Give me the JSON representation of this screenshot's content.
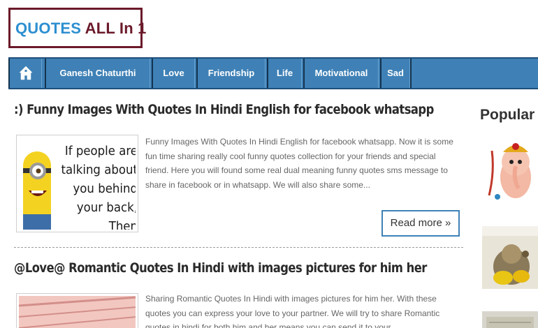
{
  "logo": {
    "part1": "QUOTES",
    "part2": "ALL In 1"
  },
  "nav": {
    "home_icon": "home-icon",
    "items": [
      {
        "label": "Ganesh Chaturthi"
      },
      {
        "label": "Love"
      },
      {
        "label": "Friendship"
      },
      {
        "label": "Life"
      },
      {
        "label": "Motivational"
      },
      {
        "label": "Sad"
      }
    ]
  },
  "posts": [
    {
      "title": ":) Funny Images With Quotes In Hindi English for facebook whatsapp",
      "thumb_text": [
        "If people are",
        "talking about",
        "you behind",
        "your back,",
        "Then"
      ],
      "excerpt": "Funny Images With Quotes In Hindi English for facebook whatsapp. Now it is some fun time sharing really cool funny quotes collection for your friends and special friend. Here you will found some real dual meaning funny quotes sms message to share in facebook or in whatsapp. We will also share some...",
      "read_more": "Read more »"
    },
    {
      "title": "@Love@ Romantic Quotes In Hindi with images pictures for him her",
      "excerpt": "Sharing Romantic Quotes In Hindi with images pictures for him her.  With these quotes you can express your love to your partner. We will try to share Romantic quotes in hindi for both him and her means you can send it to your"
    }
  ],
  "sidebar": {
    "title": "Popular"
  },
  "colors": {
    "logo_blue": "#2e8fd0",
    "logo_maroon": "#6b1a2a",
    "nav_blue": "#3f81b6",
    "read_more_border": "#3f81b6"
  }
}
